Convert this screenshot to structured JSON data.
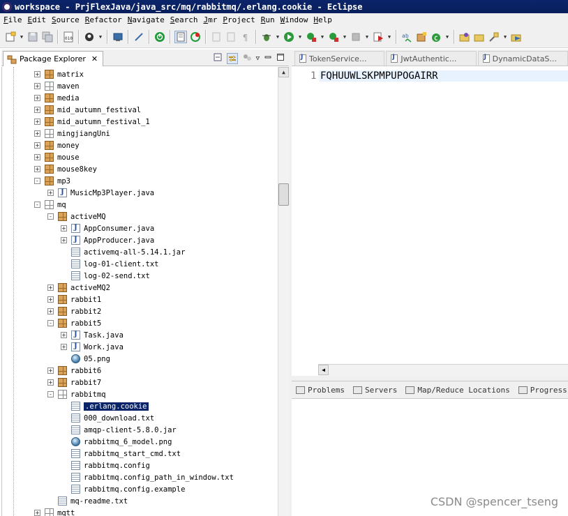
{
  "window": {
    "title": "workspace - PrjFlexJava/java_src/mq/rabbitmq/.erlang.cookie - Eclipse"
  },
  "menu": [
    "File",
    "Edit",
    "Source",
    "Refactor",
    "Navigate",
    "Search",
    "Jmr",
    "Project",
    "Run",
    "Window",
    "Help"
  ],
  "package_explorer": {
    "tab_label": "Package Explorer",
    "tree": [
      {
        "label": "matrix",
        "depth": 0,
        "icon": "package-icon",
        "expander": "+"
      },
      {
        "label": "maven",
        "depth": 0,
        "icon": "empty-package-icon",
        "expander": "+"
      },
      {
        "label": "media",
        "depth": 0,
        "icon": "package-icon",
        "expander": "+"
      },
      {
        "label": "mid_autumn_festival",
        "depth": 0,
        "icon": "package-icon",
        "expander": "+"
      },
      {
        "label": "mid_autumn_festival_1",
        "depth": 0,
        "icon": "package-icon",
        "expander": "+"
      },
      {
        "label": "mingjiangUni",
        "depth": 0,
        "icon": "empty-package-icon",
        "expander": "+"
      },
      {
        "label": "money",
        "depth": 0,
        "icon": "package-icon",
        "expander": "+"
      },
      {
        "label": "mouse",
        "depth": 0,
        "icon": "package-icon",
        "expander": "+"
      },
      {
        "label": "mouse8key",
        "depth": 0,
        "icon": "package-icon",
        "expander": "+"
      },
      {
        "label": "mp3",
        "depth": 0,
        "icon": "package-icon",
        "expander": "-"
      },
      {
        "label": "MusicMp3Player.java",
        "depth": 1,
        "icon": "java-file-icon",
        "expander": "+"
      },
      {
        "label": "mq",
        "depth": 0,
        "icon": "empty-package-icon",
        "expander": "-"
      },
      {
        "label": "activeMQ",
        "depth": 1,
        "icon": "package-icon",
        "expander": "-"
      },
      {
        "label": "AppConsumer.java",
        "depth": 2,
        "icon": "java-file-icon",
        "expander": "+"
      },
      {
        "label": "AppProducer.java",
        "depth": 2,
        "icon": "java-file-icon",
        "expander": "+"
      },
      {
        "label": "activemq-all-5.14.1.jar",
        "depth": 2,
        "icon": "text-file-icon",
        "expander": ""
      },
      {
        "label": "log-01-client.txt",
        "depth": 2,
        "icon": "text-file-icon",
        "expander": ""
      },
      {
        "label": "log-02-send.txt",
        "depth": 2,
        "icon": "text-file-icon",
        "expander": ""
      },
      {
        "label": "activeMQ2",
        "depth": 1,
        "icon": "package-icon",
        "expander": "+"
      },
      {
        "label": "rabbit1",
        "depth": 1,
        "icon": "package-icon",
        "expander": "+"
      },
      {
        "label": "rabbit2",
        "depth": 1,
        "icon": "package-icon",
        "expander": "+"
      },
      {
        "label": "rabbit5",
        "depth": 1,
        "icon": "package-icon",
        "expander": "-"
      },
      {
        "label": "Task.java",
        "depth": 2,
        "icon": "java-file-icon",
        "expander": "+"
      },
      {
        "label": "Work.java",
        "depth": 2,
        "icon": "java-file-icon",
        "expander": "+"
      },
      {
        "label": "05.png",
        "depth": 2,
        "icon": "image-file-icon",
        "expander": ""
      },
      {
        "label": "rabbit6",
        "depth": 1,
        "icon": "package-icon",
        "expander": "+"
      },
      {
        "label": "rabbit7",
        "depth": 1,
        "icon": "package-icon",
        "expander": "+"
      },
      {
        "label": "rabbitmq",
        "depth": 1,
        "icon": "empty-package-icon",
        "expander": "-"
      },
      {
        "label": ".erlang.cookie",
        "depth": 2,
        "icon": "text-file-icon",
        "expander": "",
        "selected": true
      },
      {
        "label": "000_download.txt",
        "depth": 2,
        "icon": "text-file-icon",
        "expander": ""
      },
      {
        "label": "amqp-client-5.8.0.jar",
        "depth": 2,
        "icon": "text-file-icon",
        "expander": ""
      },
      {
        "label": "rabbitmq_6_model.png",
        "depth": 2,
        "icon": "image-file-icon",
        "expander": ""
      },
      {
        "label": "rabbitmq_start_cmd.txt",
        "depth": 2,
        "icon": "text-file-icon",
        "expander": ""
      },
      {
        "label": "rabbitmq.config",
        "depth": 2,
        "icon": "text-file-icon",
        "expander": ""
      },
      {
        "label": "rabbitmq.config_path_in_window.txt",
        "depth": 2,
        "icon": "text-file-icon",
        "expander": ""
      },
      {
        "label": "rabbitmq.config.example",
        "depth": 2,
        "icon": "text-file-icon",
        "expander": ""
      },
      {
        "label": "mq-readme.txt",
        "depth": 1,
        "icon": "text-file-icon",
        "expander": ""
      },
      {
        "label": "mqtt",
        "depth": 0,
        "icon": "empty-package-icon",
        "expander": "+"
      }
    ]
  },
  "editor": {
    "tabs": [
      {
        "label": "TokenService...",
        "icon": "java-file-icon"
      },
      {
        "label": "JwtAuthentic...",
        "icon": "java-file-icon"
      },
      {
        "label": "DynamicDataS...",
        "icon": "java-file-icon"
      }
    ],
    "line_number": "1",
    "content": "FQHUUWLSKPMPUPOGAIRR"
  },
  "bottom_panel": {
    "tabs": [
      {
        "label": "Problems",
        "icon": "problems-icon"
      },
      {
        "label": "Servers",
        "icon": "servers-icon"
      },
      {
        "label": "Map/Reduce Locations",
        "icon": "map-reduce-icon"
      },
      {
        "label": "Progress",
        "icon": "progress-icon"
      }
    ]
  },
  "watermark": "CSDN @spencer_tseng",
  "colors": {
    "title_bar": "#0a246a",
    "selection": "#0a246a",
    "current_line": "#e8f2fe"
  }
}
